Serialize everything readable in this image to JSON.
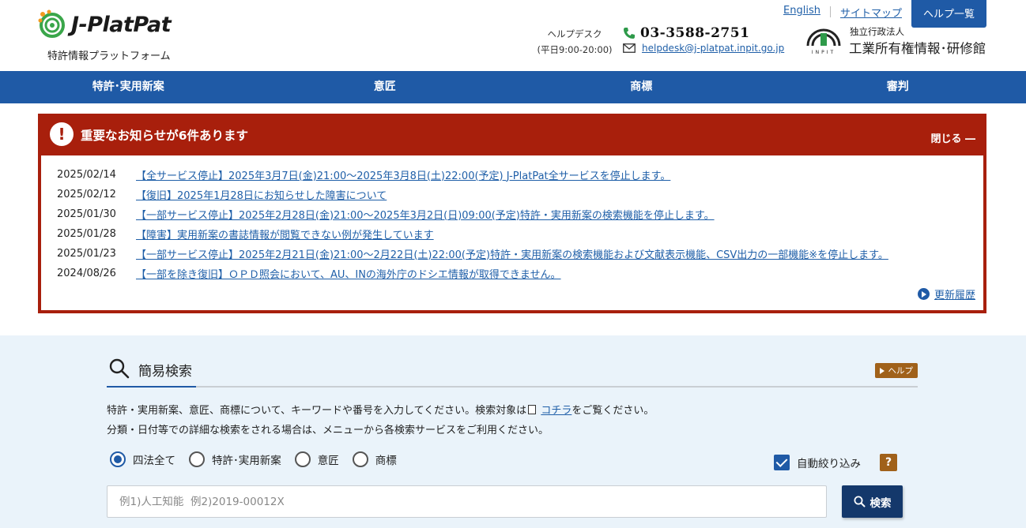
{
  "header": {
    "logo_text": "J-PlatPat",
    "logo_sub": "特許情報プラットフォーム",
    "top_links": {
      "english": "English",
      "sitemap": "サイトマップ",
      "help_list": "ヘルプ一覧"
    },
    "helpdesk_label": "ヘルプデスク",
    "helpdesk_hours": "(平日9:00-20:00)",
    "phone": "03-3588-2751",
    "email": "helpdesk@j-platpat.inpit.go.jp",
    "inpit_small": "独立行政法人",
    "inpit_big": "工業所有権情報･研修館",
    "inpit_caption": "INPIT"
  },
  "nav": [
    "特許･実用新案",
    "意匠",
    "商標",
    "審判"
  ],
  "notice": {
    "title": "重要なお知らせが6件あります",
    "close": "閉じる ―",
    "items": [
      {
        "date": "2025/02/14",
        "text": "【全サービス停止】2025年3月7日(金)21:00～2025年3月8日(土)22:00(予定) J-PlatPat全サービスを停止します。"
      },
      {
        "date": "2025/02/12",
        "text": "【復旧】2025年1月28日にお知らせした障害について"
      },
      {
        "date": "2025/01/30",
        "text": "【一部サービス停止】2025年2月28日(金)21:00～2025年3月2日(日)09:00(予定)特許・実用新案の検索機能を停止します。"
      },
      {
        "date": "2025/01/28",
        "text": "【障害】実用新案の書誌情報が閲覧できない例が発生しています"
      },
      {
        "date": "2025/01/23",
        "text": "【一部サービス停止】2025年2月21日(金)21:00～2月22日(土)22:00(予定)特許・実用新案の検索機能および文献表示機能、CSV出力の一部機能※を停止します。"
      },
      {
        "date": "2024/08/26",
        "text": "【一部を除き復旧】ＯＰＤ照会において、AU、INの海外庁のドシエ情報が取得できません。"
      }
    ],
    "history": "更新履歴"
  },
  "search": {
    "title": "簡易検索",
    "help_tag": "ヘルプ",
    "desc1_before": "特許・実用新案、意匠、商標について、キーワードや番号を入力してください。検索対象は",
    "desc1_link": "コチラ",
    "desc1_after": "をご覧ください。",
    "desc2": "分類・日付等での詳細な検索をされる場合は、メニューから各検索サービスをご利用ください。",
    "radios": [
      "四法全て",
      "特許･実用新案",
      "意匠",
      "商標"
    ],
    "selected_radio": "四法全て",
    "auto_label": "自動絞り込み",
    "auto_checked": true,
    "q_label": "?",
    "placeholder": "例1)人工知能  例2)2019-00012X",
    "button": "検索"
  },
  "colors": {
    "nav_blue": "#1f5aa6",
    "notice_red": "#a81f0c",
    "search_bg": "#eaf3fa",
    "help_brown": "#a0611a",
    "search_btn": "#14386b"
  }
}
